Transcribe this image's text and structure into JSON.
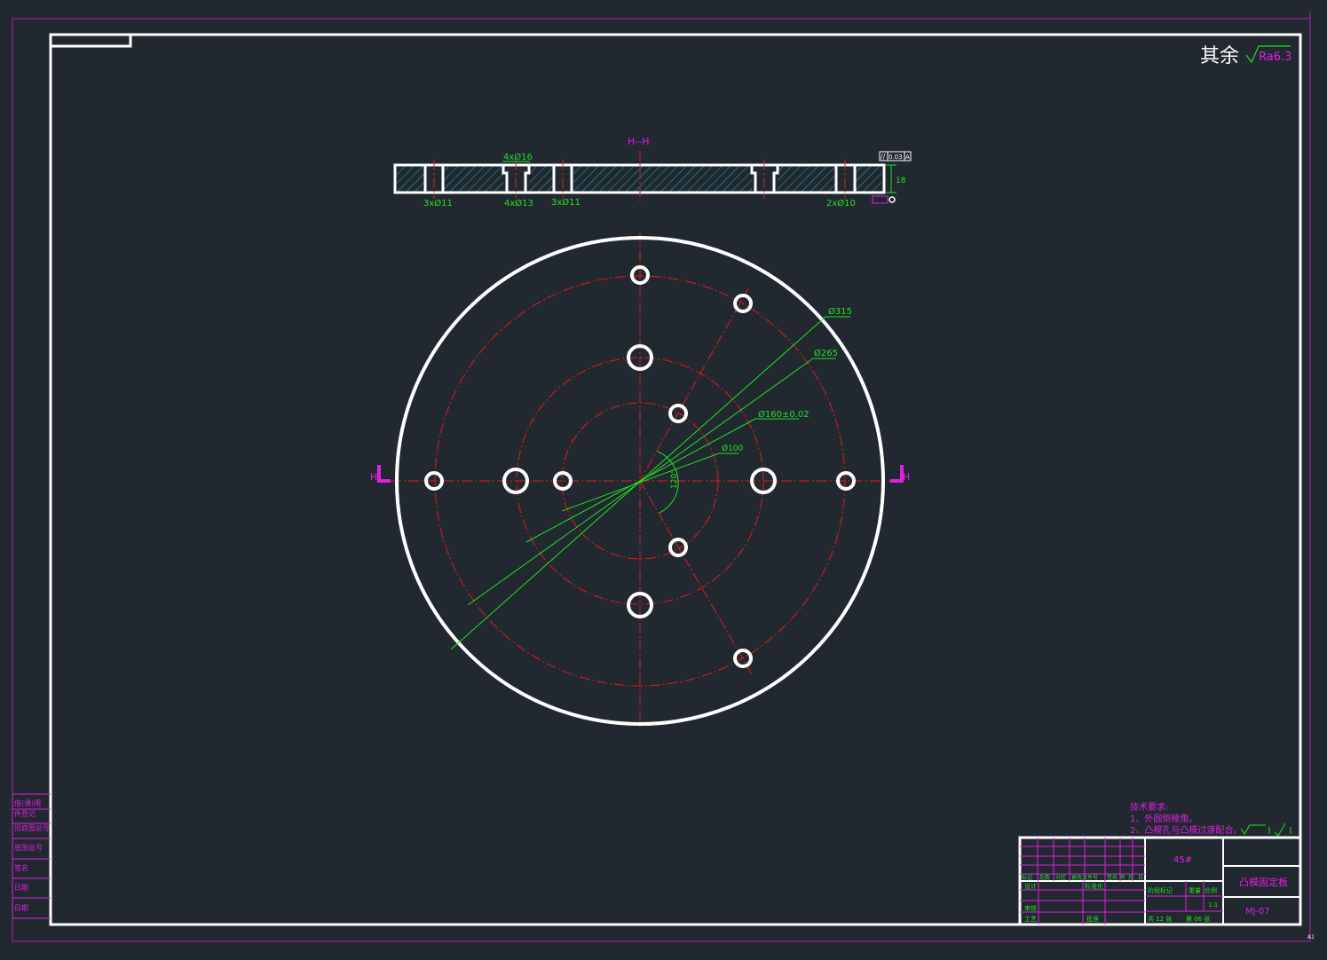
{
  "colors": {
    "background": "#212830",
    "border": "#ffffff",
    "sheet_frame": "#b01fb0",
    "centerline": "#e01c1c",
    "dimension": "#22e022",
    "annotation": "#e01fe0",
    "hatch": "#1fb5b5",
    "titleblock_grid": "#e01fe0",
    "titleblock_text": "#22e022"
  },
  "roughness": {
    "prefix": "其余",
    "value": "Ra6.3"
  },
  "section": {
    "title": "H--H",
    "top_callout": "4xØ16",
    "bottom_callouts": [
      "3xØ11",
      "4xØ13",
      "3xØ11",
      "2xØ10"
    ],
    "thickness": "18",
    "parallelism": "0.03",
    "datum": "A"
  },
  "plan": {
    "section_mark_left": "H",
    "section_mark_right": "H",
    "dimensions": [
      "Ø315",
      "Ø265",
      "Ø160±0.02",
      "Ø100"
    ],
    "angle": "120°"
  },
  "tech_requirements": {
    "heading": "技术要求:",
    "items": [
      "1、外圆倒棱角。",
      "2、凸模孔与凸模过渡配合。"
    ]
  },
  "left_strip": [
    "借(通)用",
    "件登记",
    "旧底图总号",
    "底图总号",
    "签名",
    "日期",
    "日期"
  ],
  "title_block": {
    "material": "45#",
    "part_name": "凸模固定板",
    "drawing_no": "MJ-07",
    "header_cells": [
      "标记",
      "处数",
      "分区",
      "更改文件号",
      "签名",
      "年",
      "月",
      "日"
    ],
    "role_labels": [
      "设计",
      "标准化",
      "审核",
      "工艺",
      "批准"
    ],
    "stage_cells": [
      "阶段标记",
      "重量",
      "比例"
    ],
    "scale": "1:1",
    "sheets_total": "共 12 张",
    "sheet_no": "第 06 张"
  },
  "corner_mark": "A1"
}
